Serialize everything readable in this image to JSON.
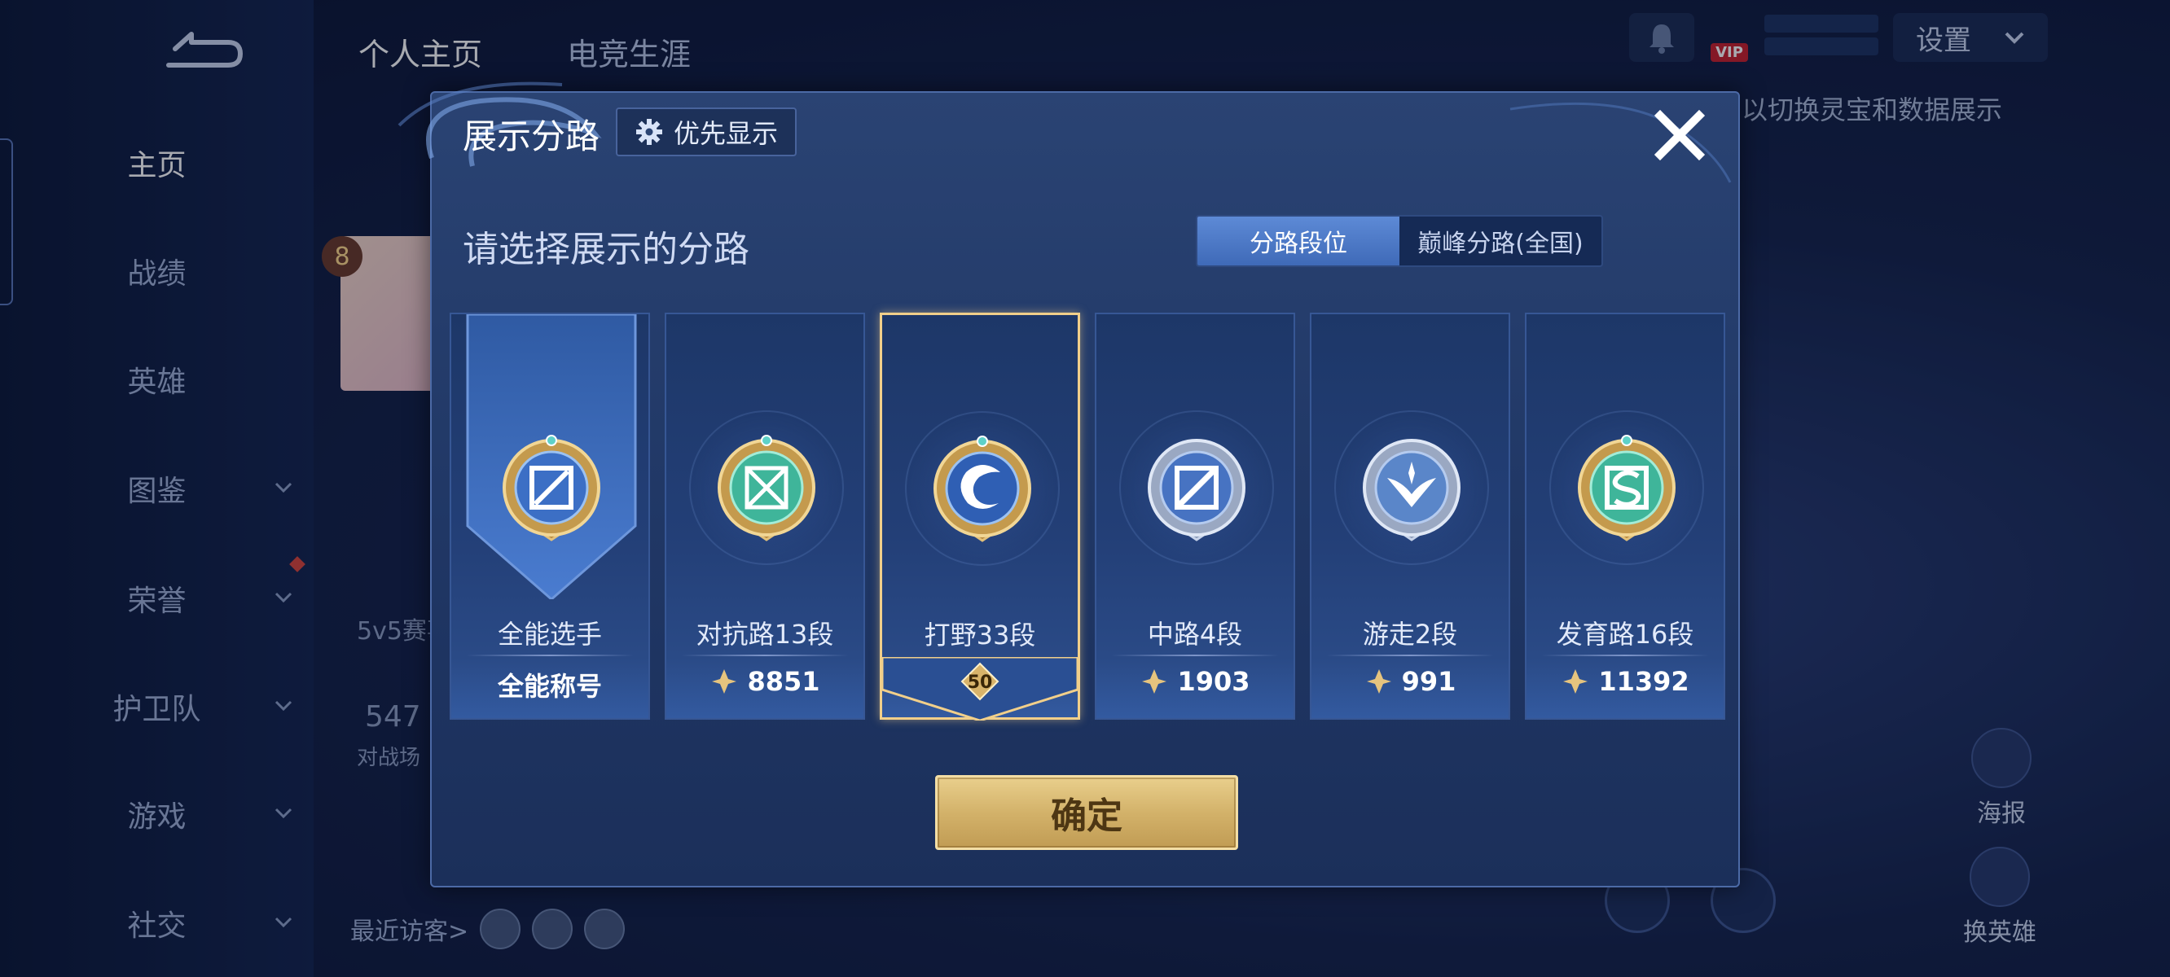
{
  "sidebar": {
    "items": [
      {
        "label": "主页",
        "active": true
      },
      {
        "label": "战绩"
      },
      {
        "label": "英雄"
      },
      {
        "label": "图鉴"
      },
      {
        "label": "荣誉"
      },
      {
        "label": "护卫队"
      },
      {
        "label": "游戏"
      },
      {
        "label": "社交"
      }
    ]
  },
  "header": {
    "tabs": [
      "个人主页",
      "电竞生涯"
    ],
    "vip_label": "VIP",
    "settings_label": "设置"
  },
  "background": {
    "hint_text": "以切换灵宝和数据展示",
    "level": "8",
    "mode_label": "5v5赛事",
    "stat_value": "547",
    "stat_label": "对战场",
    "recent_visitors_label": "最近访客>",
    "poster_label": "海报",
    "change_hero_label": "换英雄"
  },
  "modal": {
    "title": "展示分路",
    "priority_label": "优先显示",
    "subtitle": "请选择展示的分路",
    "segment_options": [
      "分路段位",
      "巅峰分路(全国)"
    ],
    "segment_selected": 0,
    "cards": [
      {
        "name": "全能选手",
        "value": "全能称号",
        "selected": false,
        "emblem": "all-round-emblem"
      },
      {
        "name": "对抗路13段",
        "value": "8851",
        "selected": false,
        "emblem": "clash-lane-emblem"
      },
      {
        "name": "打野33段",
        "value": "50",
        "selected": true,
        "emblem": "jungle-emblem"
      },
      {
        "name": "中路4段",
        "value": "1903",
        "selected": false,
        "emblem": "mid-lane-emblem"
      },
      {
        "name": "游走2段",
        "value": "991",
        "selected": false,
        "emblem": "roam-emblem"
      },
      {
        "name": "发育路16段",
        "value": "11392",
        "selected": false,
        "emblem": "farm-lane-emblem"
      }
    ],
    "confirm_label": "确定"
  },
  "colors": {
    "accent_gold": "#f1cf8a",
    "segment_active": "#4f7cc8",
    "modal_bg": "#233c6b"
  }
}
